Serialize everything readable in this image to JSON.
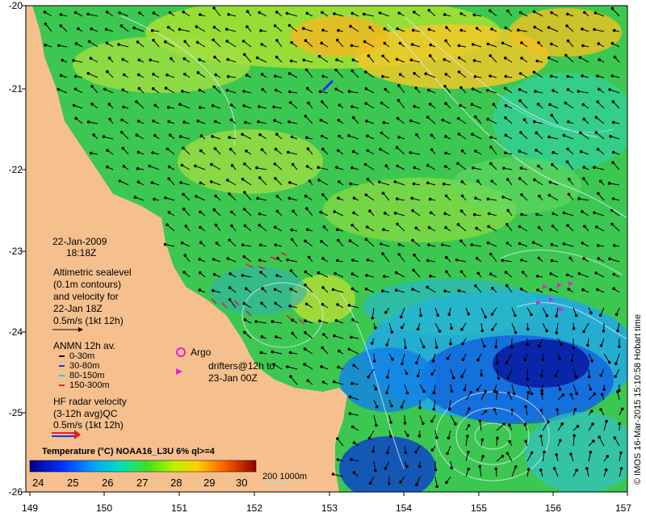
{
  "map": {
    "x_axis_ticks": [
      "149",
      "150",
      "151",
      "152",
      "153",
      "154",
      "155",
      "156",
      "157"
    ],
    "y_axis_ticks": [
      "-20",
      "-21",
      "-22",
      "-23",
      "-24",
      "-25",
      "-26"
    ],
    "land_color": "#f6c08e",
    "date": "22-Jan-2009",
    "time": "18:18Z",
    "credit": "© IMOS 16-Mar-2015 15:10:58 Hobart time"
  },
  "legend": {
    "altimetry": [
      "Altimetric sealevel",
      "(0.1m contours)",
      "and velocity for",
      "22-Jan 18Z",
      "0.5m/s (1kt 12h)"
    ],
    "anmn_title": "ANMN 12h av.",
    "anmn_items": [
      {
        "label": "0-30m",
        "color": "#000000"
      },
      {
        "label": "30-80m",
        "color": "#1030ff"
      },
      {
        "label": "80-150m",
        "color": "#20d0d0"
      },
      {
        "label": "150-300m",
        "color": "#e02020"
      }
    ],
    "argo_label": "Argo",
    "drifters": [
      "drifters@12h to",
      "23-Jan 00Z"
    ],
    "argo_color": "#e020e0",
    "hf_radar": [
      "HF radar velocity",
      "(3-12h avg)QC",
      "0.5m/s (1kt 12h)"
    ],
    "colorbar_title": "Temperature (°C) NOAA16_L3U 6% ql>=4",
    "colorbar_ticks": [
      "24",
      "25",
      "26",
      "27",
      "28",
      "29",
      "30"
    ],
    "isobath_label": "200  1000m"
  }
}
